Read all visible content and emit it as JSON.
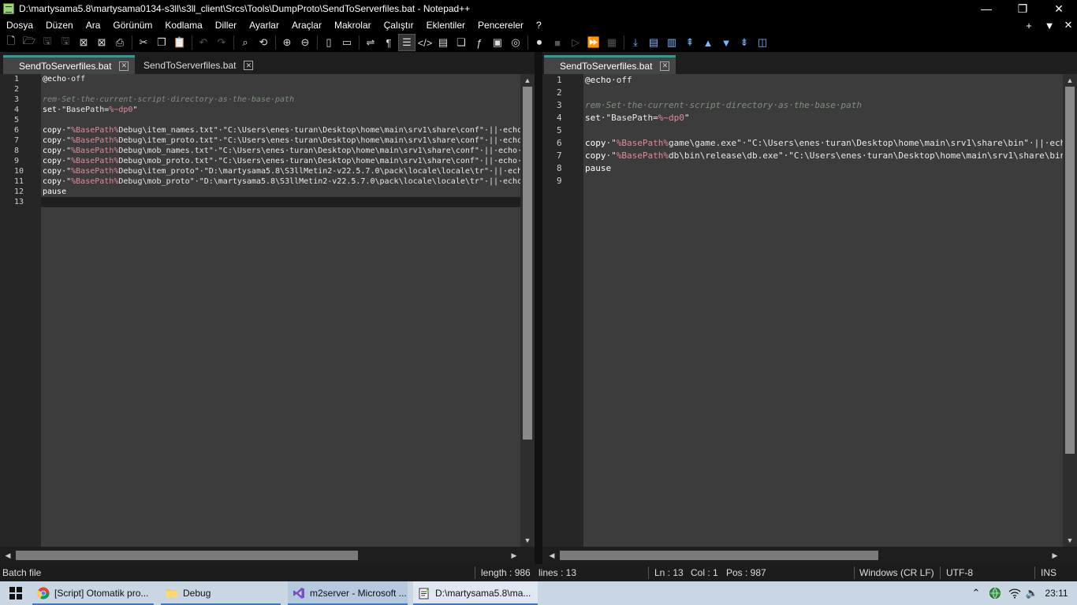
{
  "window": {
    "title": "D:\\martysama5.8\\martysama0134-s3ll\\s3ll_client\\Srcs\\Tools\\DumpProto\\SendToServerfiles.bat - Notepad++",
    "minimize": "—",
    "restore": "❐",
    "close": "✕"
  },
  "menu": {
    "items": [
      "Dosya",
      "Düzen",
      "Ara",
      "Görünüm",
      "Kodlama",
      "Diller",
      "Ayarlar",
      "Araçlar",
      "Makrolar",
      "Çalıştır",
      "Eklentiler",
      "Pencereler",
      "?"
    ],
    "plus": "+",
    "dropdown": "▼",
    "close": "✕"
  },
  "toolbar": {
    "icons": [
      "new-file-icon",
      "open-file-icon",
      "save-icon",
      "save-all-icon",
      "close-icon",
      "close-all-icon",
      "print-icon",
      "cut-icon",
      "copy-icon",
      "paste-icon",
      "undo-icon",
      "redo-icon",
      "find-icon",
      "replace-icon",
      "zoom-in-icon",
      "zoom-out-icon",
      "sync-vertical-icon",
      "sync-horizontal-icon",
      "word-wrap-icon",
      "show-all-chars-icon",
      "indent-guide-icon",
      "xml-tag-icon",
      "document-map-icon",
      "document-list-icon",
      "function-list-icon",
      "folder-workspace-icon",
      "monitoring-icon",
      "record-macro-icon",
      "stop-record-icon",
      "play-macro-icon",
      "run-macro-multiple-icon",
      "save-macro-icon"
    ]
  },
  "left": {
    "tabs": [
      {
        "label": "SendToServerfiles.bat",
        "active": true
      },
      {
        "label": "SendToServerfiles.bat",
        "active": false
      }
    ],
    "line_numbers": [
      "1",
      "2",
      "3",
      "4",
      "5",
      "6",
      "7",
      "8",
      "9",
      "10",
      "11",
      "12",
      "13"
    ],
    "lines": [
      [
        {
          "t": "@echo",
          "c": "kw"
        },
        {
          "t": "·off",
          "c": "str"
        }
      ],
      [],
      [
        {
          "t": "rem·Set·the·current·script·directory·as·the·base·path",
          "c": "cmt"
        }
      ],
      [
        {
          "t": "set",
          "c": "kw"
        },
        {
          "t": "·\"BasePath=",
          "c": "str"
        },
        {
          "t": "%~dp0",
          "c": "var"
        },
        {
          "t": "\"",
          "c": "str"
        }
      ],
      [],
      [
        {
          "t": "copy",
          "c": "kw"
        },
        {
          "t": "·\"",
          "c": "str"
        },
        {
          "t": "%BasePath%",
          "c": "var"
        },
        {
          "t": "Debug\\item_names.txt\"·\"C:\\Users\\enes·turan\\Desktop\\home\\main\\srv1\\share\\conf\"·||·echo·E",
          "c": "str"
        }
      ],
      [
        {
          "t": "copy",
          "c": "kw"
        },
        {
          "t": "·\"",
          "c": "str"
        },
        {
          "t": "%BasePath%",
          "c": "var"
        },
        {
          "t": "Debug\\item_proto.txt\"·\"C:\\Users\\enes·turan\\Desktop\\home\\main\\srv1\\share\\conf\"·||·echo·E",
          "c": "str"
        }
      ],
      [
        {
          "t": "copy",
          "c": "kw"
        },
        {
          "t": "·\"",
          "c": "str"
        },
        {
          "t": "%BasePath%",
          "c": "var"
        },
        {
          "t": "Debug\\mob_names.txt\"·\"C:\\Users\\enes·turan\\Desktop\\home\\main\\srv1\\share\\conf\"·||·echo·Er",
          "c": "str"
        }
      ],
      [
        {
          "t": "copy",
          "c": "kw"
        },
        {
          "t": "·\"",
          "c": "str"
        },
        {
          "t": "%BasePath%",
          "c": "var"
        },
        {
          "t": "Debug\\mob_proto.txt\"·\"C:\\Users\\enes·turan\\Desktop\\home\\main\\srv1\\share\\conf\"·||·echo·Er",
          "c": "str"
        }
      ],
      [
        {
          "t": "copy",
          "c": "kw"
        },
        {
          "t": "·\"",
          "c": "str"
        },
        {
          "t": "%BasePath%",
          "c": "var"
        },
        {
          "t": "Debug\\item_proto\"·\"D:\\martysama5.8\\S3llMetin2-v22.5.7.0\\pack\\locale\\locale\\tr\"·||·echo·",
          "c": "str"
        }
      ],
      [
        {
          "t": "copy",
          "c": "kw"
        },
        {
          "t": "·\"",
          "c": "str"
        },
        {
          "t": "%BasePath%",
          "c": "var"
        },
        {
          "t": "Debug\\mob_proto\"·\"D:\\martysama5.8\\S3llMetin2-v22.5.7.0\\pack\\locale\\locale\\tr\"·||·echo·E",
          "c": "str"
        }
      ],
      [
        {
          "t": "pause",
          "c": "kw"
        }
      ],
      []
    ]
  },
  "right": {
    "tabs": [
      {
        "label": "SendToServerfiles.bat",
        "active": true
      }
    ],
    "line_numbers": [
      "1",
      "2",
      "3",
      "4",
      "5",
      "6",
      "7",
      "8",
      "9"
    ],
    "lines": [
      [
        {
          "t": "@echo",
          "c": "kw"
        },
        {
          "t": "·off",
          "c": "str"
        }
      ],
      [],
      [
        {
          "t": "rem·Set·the·current·script·directory·as·the·base·path",
          "c": "cmt"
        }
      ],
      [
        {
          "t": "set",
          "c": "kw"
        },
        {
          "t": "·\"BasePath=",
          "c": "str"
        },
        {
          "t": "%~dp0",
          "c": "var"
        },
        {
          "t": "\"",
          "c": "str"
        }
      ],
      [],
      [
        {
          "t": "copy",
          "c": "kw"
        },
        {
          "t": "·\"",
          "c": "str"
        },
        {
          "t": "%BasePath%",
          "c": "var"
        },
        {
          "t": "game\\game.exe\"·\"C:\\Users\\enes·turan\\Desktop\\home\\main\\srv1\\share\\bin\"·||·ech",
          "c": "str"
        }
      ],
      [
        {
          "t": "copy",
          "c": "kw"
        },
        {
          "t": "·\"",
          "c": "str"
        },
        {
          "t": "%BasePath%",
          "c": "var"
        },
        {
          "t": "db\\bin\\release\\db.exe\"·\"C:\\Users\\enes·turan\\Desktop\\home\\main\\srv1\\share\\bin",
          "c": "str"
        }
      ],
      [
        {
          "t": "pause",
          "c": "kw"
        }
      ],
      []
    ]
  },
  "status": {
    "file_type": "Batch file",
    "length": "length : 986",
    "lines": "lines : 13",
    "ln": "Ln : 13",
    "col": "Col : 1",
    "pos": "Pos : 987",
    "eol": "Windows (CR LF)",
    "encoding": "UTF-8",
    "mode": "INS"
  },
  "taskbar": {
    "tasks": [
      {
        "label": "[Script] Otomatik pro...",
        "icon": "chrome-icon"
      },
      {
        "label": "Debug",
        "icon": "folder-icon"
      },
      {
        "label": "m2server - Microsoft ...",
        "icon": "visual-studio-icon"
      },
      {
        "label": "D:\\martysama5.8\\ma...",
        "icon": "notepadpp-icon"
      }
    ],
    "clock": "23:11"
  }
}
